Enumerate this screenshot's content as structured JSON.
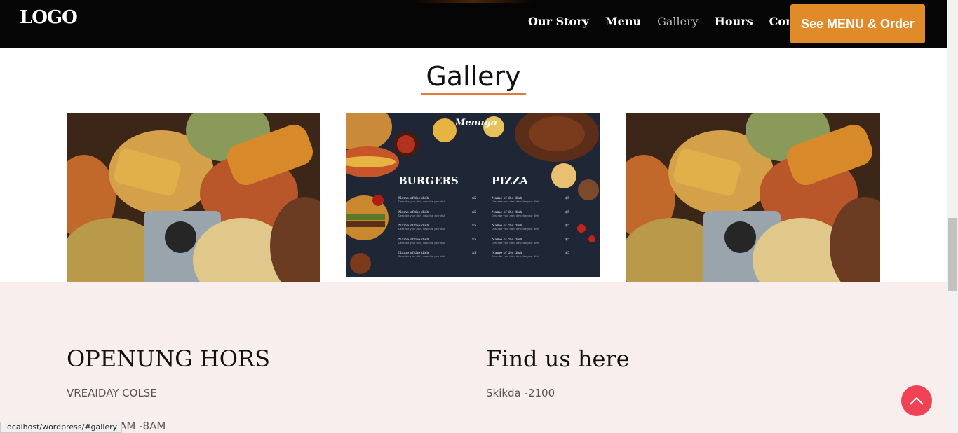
{
  "header": {
    "logo": "LOGO",
    "nav": [
      "Our Story",
      "Menu",
      "Gallery",
      "Hours",
      "Contact"
    ],
    "active": "Gallery",
    "cta": "See MENU & Order"
  },
  "gallery": {
    "title": "Gallery",
    "images": [
      {
        "kind": "food-photo"
      },
      {
        "kind": "menu-board",
        "brand": "Menugo",
        "left_heading": "BURGERS",
        "right_heading": "PIZZA",
        "dish": "Name of the dish",
        "desc": "Describe your dish, describe your dish",
        "price": "$5"
      },
      {
        "kind": "food-photo"
      }
    ]
  },
  "footer": {
    "hours_heading": "OPENUNG HORS",
    "hours_line1": "VREAIDAY COLSE",
    "hours_line2": "SANDAY 7AM -8AM",
    "find_heading": "Find us here",
    "address": "Skikda -2100"
  },
  "status_url": "localhost/wordpress/#gallery",
  "colors": {
    "accent": "#e08a2a",
    "to_top": "#ef4255",
    "footer_bg": "#f8eeed",
    "underline": "#e07a3a"
  }
}
